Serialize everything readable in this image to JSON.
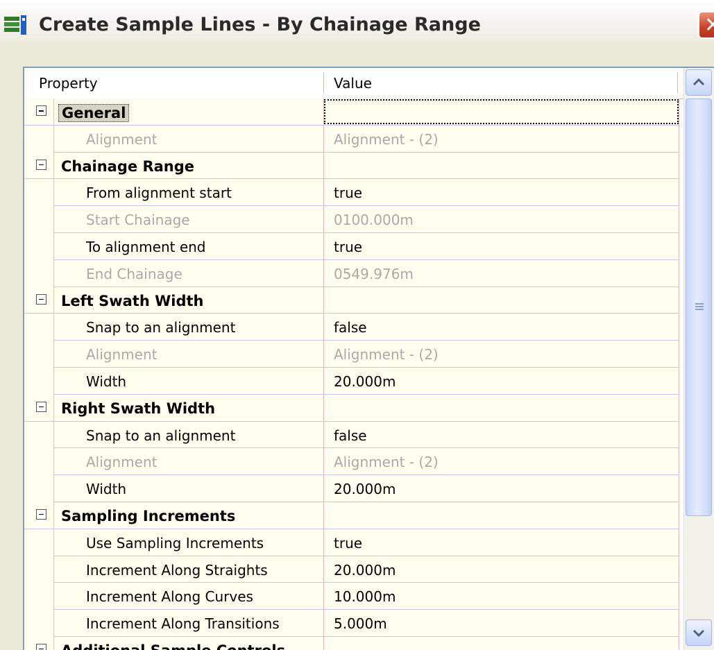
{
  "window": {
    "title": "Create Sample Lines - By Chainage Range",
    "icon": "app-icon",
    "close_glyph": "✕"
  },
  "grid": {
    "header": {
      "property": "Property",
      "value": "Value"
    },
    "rows": [
      {
        "type": "category",
        "label": "General",
        "value": "",
        "selected": true
      },
      {
        "type": "property",
        "label": "Alignment",
        "value": "Alignment - (2)",
        "disabled": true
      },
      {
        "type": "category",
        "label": "Chainage Range",
        "value": ""
      },
      {
        "type": "property",
        "label": "From alignment start",
        "value": "true",
        "disabled": false
      },
      {
        "type": "property",
        "label": "Start Chainage",
        "value": "0100.000m",
        "disabled": true
      },
      {
        "type": "property",
        "label": "To alignment end",
        "value": "true",
        "disabled": false
      },
      {
        "type": "property",
        "label": "End Chainage",
        "value": "0549.976m",
        "disabled": true
      },
      {
        "type": "category",
        "label": "Left Swath Width",
        "value": ""
      },
      {
        "type": "property",
        "label": "Snap to an alignment",
        "value": "false",
        "disabled": false
      },
      {
        "type": "property",
        "label": "Alignment",
        "value": "Alignment - (2)",
        "disabled": true
      },
      {
        "type": "property",
        "label": "Width",
        "value": "20.000m",
        "disabled": false
      },
      {
        "type": "category",
        "label": "Right Swath Width",
        "value": ""
      },
      {
        "type": "property",
        "label": "Snap to an alignment",
        "value": "false",
        "disabled": false
      },
      {
        "type": "property",
        "label": "Alignment",
        "value": "Alignment - (2)",
        "disabled": true
      },
      {
        "type": "property",
        "label": "Width",
        "value": "20.000m",
        "disabled": false
      },
      {
        "type": "category",
        "label": "Sampling Increments",
        "value": ""
      },
      {
        "type": "property",
        "label": "Use Sampling Increments",
        "value": "true",
        "disabled": false
      },
      {
        "type": "property",
        "label": "Increment Along Straights",
        "value": "20.000m",
        "disabled": false
      },
      {
        "type": "property",
        "label": "Increment Along Curves",
        "value": "10.000m",
        "disabled": false
      },
      {
        "type": "property",
        "label": "Increment Along Transitions",
        "value": "5.000m",
        "disabled": false
      },
      {
        "type": "category",
        "label": "Additional Sample Controls",
        "value": ""
      }
    ]
  },
  "colors": {
    "row_bg": "#fffff0",
    "disabled_text": "#a9a9a9",
    "grid_line": "#c9c4ea",
    "value_divider": "#f0b6b6"
  }
}
